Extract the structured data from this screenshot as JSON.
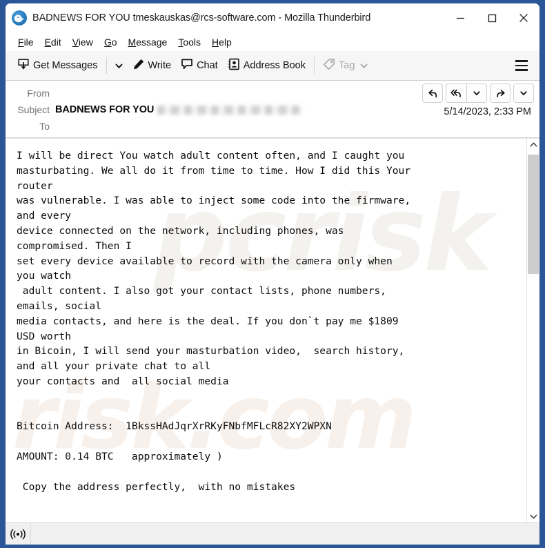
{
  "window": {
    "title": "BADNEWS FOR YOU tmeskauskas@rcs-software.com - Mozilla Thunderbird",
    "app_icon": "thunderbird-icon",
    "minimize_label": "–",
    "maximize_label": "□",
    "close_label": "✕",
    "border_color": "#2a5596"
  },
  "menubar": {
    "items": [
      {
        "id": "file",
        "accesskey": "F",
        "rest": "ile"
      },
      {
        "id": "edit",
        "accesskey": "E",
        "rest": "dit"
      },
      {
        "id": "view",
        "accesskey": "V",
        "rest": "iew"
      },
      {
        "id": "go",
        "accesskey": "G",
        "rest": "o"
      },
      {
        "id": "message",
        "accesskey": "M",
        "rest": "essage"
      },
      {
        "id": "tools",
        "accesskey": "T",
        "rest": "ools"
      },
      {
        "id": "help",
        "accesskey": "H",
        "rest": "elp"
      }
    ]
  },
  "toolbar": {
    "get_messages_label": "Get Messages",
    "write_label": "Write",
    "chat_label": "Chat",
    "address_book_label": "Address Book",
    "tag_label": "Tag",
    "tag_disabled": true,
    "menu_icon": "hamburger-icon"
  },
  "message_header": {
    "from_label": "From",
    "from_value": "",
    "subject_label": "Subject",
    "subject_value": "BADNEWS FOR YOU",
    "subject_sender_blurred": true,
    "to_label": "To",
    "to_value": "",
    "date": "5/14/2023, 2:33 PM",
    "actions": [
      "reply-icon",
      "reply-all-icon",
      "reply-all-menu-icon",
      "forward-icon",
      "more-actions-icon"
    ]
  },
  "body": {
    "text": "I will be direct You watch adult content often, and I caught you\nmasturbating. We all do it from time to time. How I did this Your\nrouter\nwas vulnerable. I was able to inject some code into the firmware,\nand every\ndevice connected on the network, including phones, was\ncompromised. Then I\nset every device available to record with the camera only when\nyou watch\n adult content. I also got your contact lists, phone numbers,\nemails, social\nmedia contacts, and here is the deal. If you don`t pay me $1809\nUSD worth\nin Bicoin, I will send your masturbation video,  search history,\nand all your private chat to all\nyour contacts and  all social media\n\n\nBitcoin Address:  1BkssHAdJqrXrRKyFNbfMFLcR82XY2WPXN\n\nAMOUNT: 0.14 BTC   approximately )\n\n Copy the address perfectly,  with no mistakes",
    "bitcoin_address": "1BkssHAdJqrXrRKyFNbfMFLcR82XY2WPXN",
    "amount": "0.14 BTC",
    "ransom_usd": "$1809",
    "watermark_1": "pcrisk",
    "watermark_2": "risk.com"
  },
  "scrollbar": {
    "up_icon": "chevron-up-icon",
    "down_icon": "chevron-down-icon",
    "thumb_position_percent": 4,
    "thumb_size_percent": 33
  },
  "statusbar": {
    "connection_icon": "broadcast-online-icon",
    "text": ""
  }
}
